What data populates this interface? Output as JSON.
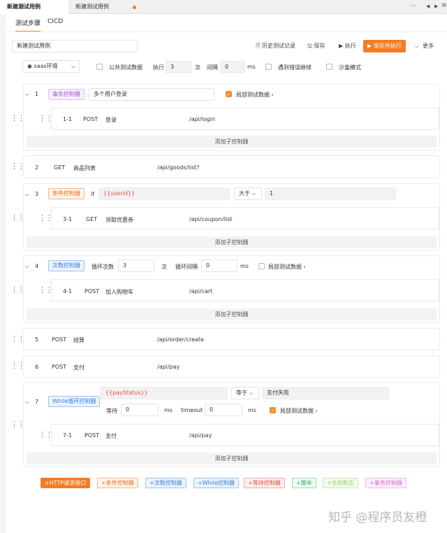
{
  "tabs": [
    {
      "label": "新建测试用例",
      "active": true
    },
    {
      "label": "新建测试用例",
      "active": false,
      "modified": true
    }
  ],
  "window_icons": {
    "more": "more-icon",
    "prev": "triangle-left-icon",
    "next": "triangle-right-icon",
    "menu": "menu-icon"
  },
  "subtabs": [
    {
      "label": "测试步骤",
      "active": true
    },
    {
      "label": "CICD",
      "active": false
    }
  ],
  "case_name": "新建测试用例",
  "toolbar": {
    "history": "历史测试记录",
    "save": "保存",
    "run": "执行",
    "save_run": "保存并执行",
    "more": "更多"
  },
  "options": {
    "env": "saas环境",
    "public_data": "公共测试数据",
    "exec_label": "执行",
    "exec_count": "3",
    "exec_unit": "次",
    "interval_label": "间隔",
    "interval_value": "0",
    "interval_unit": "ms",
    "continue_on_error": "遇到错误继续",
    "sandbox": "沙盒模式"
  },
  "steps": {
    "s1": {
      "num": "1",
      "tag": "事务控制器",
      "name": "多个用户登录",
      "local_data": "局部测试数据",
      "child": {
        "num": "1-1",
        "method": "POST",
        "name": "登录",
        "path": "/api/login"
      }
    },
    "s2": {
      "num": "2",
      "method": "GET",
      "name": "商品列表",
      "path": "/api/goods/list?"
    },
    "s3": {
      "num": "3",
      "tag": "条件控制器",
      "if": "if",
      "var": "{{userid}}",
      "op": "大于",
      "value": "1",
      "child": {
        "num": "3-1",
        "method": "GET",
        "name": "领取优惠券",
        "path": "/api/coupon/list"
      }
    },
    "s4": {
      "num": "4",
      "tag": "次数控制器",
      "loop_label": "循环次数",
      "loop_count": "3",
      "loop_unit": "次",
      "interval_label": "循环间隔",
      "interval_value": "0",
      "interval_unit": "ms",
      "local_data": "局部测试数据",
      "child": {
        "num": "4-1",
        "method": "POST",
        "name": "加入购物车",
        "path": "/api/cart"
      }
    },
    "s5": {
      "num": "5",
      "method": "POST",
      "name": "结算",
      "path": "/api/order/create"
    },
    "s6": {
      "num": "6",
      "method": "POST",
      "name": "支付",
      "path": "/api/pay"
    },
    "s7": {
      "num": "7",
      "tag": "While循环控制器",
      "var": "{{payStatus}}",
      "op": "等于",
      "value": "支付失败",
      "wait_label": "等待",
      "wait_value": "0",
      "wait_unit": "ms",
      "timeout_label": "timeout",
      "timeout_value": "0",
      "timeout_unit": "ms",
      "local_data": "局部测试数据",
      "child": {
        "num": "7-1",
        "method": "POST",
        "name": "支付",
        "path": "/api/pay"
      }
    }
  },
  "add_sub": "添加子控制器",
  "add_buttons": {
    "http": "HTTP请求接口",
    "cond": "条件控制器",
    "count": "次数控制器",
    "while": "While控制器",
    "wait": "等待控制器",
    "script": "脚本",
    "global": "全局断言",
    "txn": "事务控制器"
  },
  "watermark": "知乎 @程序员友橙",
  "colors": {
    "accent": "#f57c25",
    "purple": "#a25ad6",
    "blue": "#3f7fd8",
    "red": "#e84c3d",
    "green": "#2fb36a",
    "pink": "#d56bd1"
  }
}
